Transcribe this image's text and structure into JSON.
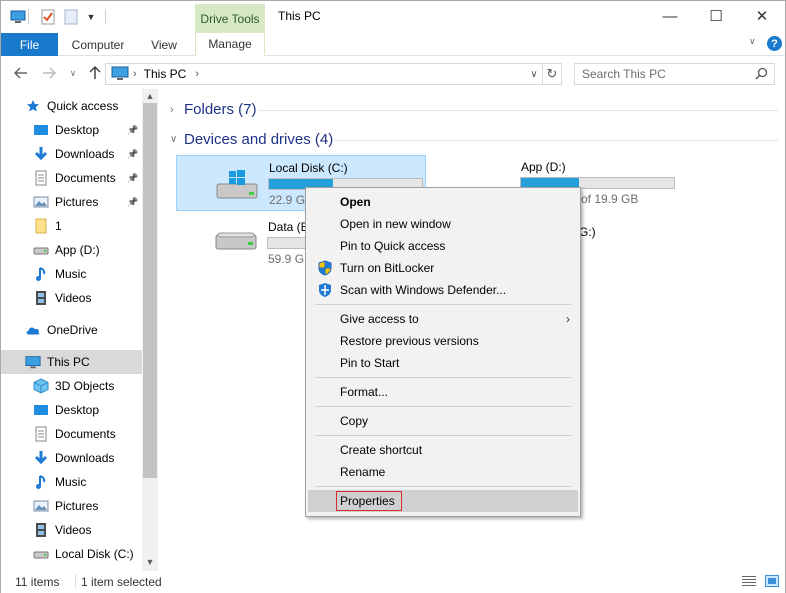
{
  "window": {
    "title": "This PC",
    "contextual_tab_group": "Drive Tools",
    "buttons": {
      "minimize": "—",
      "maximize": "☐",
      "close": "✕"
    }
  },
  "ribbon": {
    "tabs": [
      "File",
      "Computer",
      "View",
      "Manage"
    ],
    "help": "?"
  },
  "navigation": {
    "breadcrumb": [
      "This PC"
    ],
    "search_placeholder": "Search This PC"
  },
  "sidebar": {
    "items": [
      {
        "label": "Quick access",
        "icon": "star-icon",
        "pinned": false
      },
      {
        "label": "Desktop",
        "icon": "desktop-folder-icon",
        "pinned": true
      },
      {
        "label": "Downloads",
        "icon": "download-arrow-icon",
        "pinned": true
      },
      {
        "label": "Documents",
        "icon": "documents-icon",
        "pinned": true
      },
      {
        "label": "Pictures",
        "icon": "pictures-icon",
        "pinned": true
      },
      {
        "label": "1",
        "icon": "folder-icon",
        "pinned": false
      },
      {
        "label": "App (D:)",
        "icon": "drive-icon",
        "pinned": false
      },
      {
        "label": "Music",
        "icon": "music-note-icon",
        "pinned": false
      },
      {
        "label": "Videos",
        "icon": "film-icon",
        "pinned": false
      },
      {
        "label": "OneDrive",
        "icon": "cloud-icon",
        "pinned": false
      },
      {
        "label": "This PC",
        "icon": "computer-icon",
        "pinned": false,
        "selected": true
      },
      {
        "label": "3D Objects",
        "icon": "cube-icon",
        "pinned": false
      },
      {
        "label": "Desktop",
        "icon": "desktop-folder-icon",
        "pinned": false
      },
      {
        "label": "Documents",
        "icon": "documents-icon",
        "pinned": false
      },
      {
        "label": "Downloads",
        "icon": "download-arrow-icon",
        "pinned": false
      },
      {
        "label": "Music",
        "icon": "music-note-icon",
        "pinned": false
      },
      {
        "label": "Pictures",
        "icon": "pictures-icon",
        "pinned": false
      },
      {
        "label": "Videos",
        "icon": "film-icon",
        "pinned": false
      },
      {
        "label": "Local Disk (C:)",
        "icon": "drive-icon",
        "pinned": false
      }
    ]
  },
  "content": {
    "groups": [
      {
        "label": "Folders (7)",
        "expanded": false
      },
      {
        "label": "Devices and drives (4)",
        "expanded": true
      }
    ],
    "drives": [
      {
        "name": "Local Disk (C:)",
        "free_text": "22.9 GB",
        "usage": 0.42,
        "selected": true
      },
      {
        "name": "App (D:)",
        "free_text": "of 19.9 GB",
        "usage": 0.38,
        "selected": false
      },
      {
        "name": "Data (E",
        "free_text": "59.9 G",
        "usage": 0.0,
        "selected": false
      },
      {
        "name": "G:)",
        "free_text": "",
        "usage": 0.0,
        "selected": false
      }
    ]
  },
  "context_menu": {
    "items": [
      {
        "label": "Open",
        "bold": true
      },
      {
        "label": "Open in new window"
      },
      {
        "label": "Pin to Quick access"
      },
      {
        "label": "Turn on BitLocker",
        "icon": "shield-icon"
      },
      {
        "label": "Scan with Windows Defender...",
        "icon": "defender-icon"
      },
      {
        "label": "Give access to",
        "submenu": true
      },
      {
        "label": "Restore previous versions"
      },
      {
        "label": "Pin to Start"
      },
      {
        "label": "Format..."
      },
      {
        "label": "Copy"
      },
      {
        "label": "Create shortcut"
      },
      {
        "label": "Rename"
      },
      {
        "label": "Properties",
        "highlighted": true
      }
    ],
    "submenu_arrow": "›"
  },
  "status_bar": {
    "item_count": "11 items",
    "selection": "1 item selected"
  },
  "colors": {
    "accent": "#1979ca",
    "drive_tools": "#d6e8c6",
    "group_heading": "#1e3287",
    "selection": "#cce8ff",
    "usage_bar": "#26a0da",
    "highlight_box": "#d32f2f"
  }
}
